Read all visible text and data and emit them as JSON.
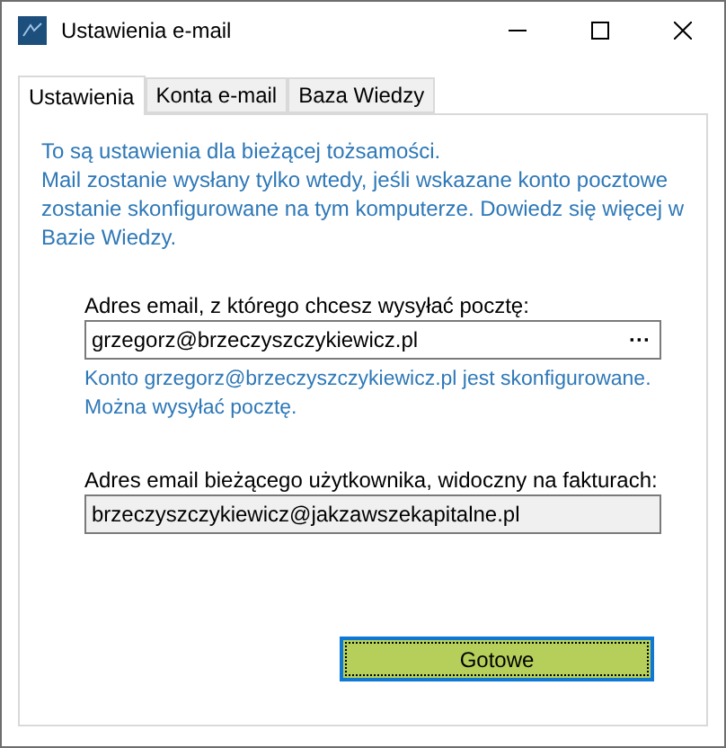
{
  "window": {
    "title": "Ustawienia e-mail"
  },
  "tabs": [
    {
      "label": "Ustawienia",
      "selected": true
    },
    {
      "label": "Konta e-mail",
      "selected": false
    },
    {
      "label": "Baza Wiedzy",
      "selected": false
    }
  ],
  "info_lines": [
    "To są ustawienia dla bieżącej tożsamości.",
    "Mail zostanie wysłany tylko wtedy, jeśli wskazane konto pocztowe zostanie skonfigurowane na tym komputerze. Dowiedz się więcej w Bazie Wiedzy."
  ],
  "sender_field": {
    "label": "Adres email, z którego chcesz wysyłać pocztę:",
    "value": "grzegorz@brzeczyszczykiewicz.pl",
    "browse_button": "···",
    "status": "Konto grzegorz@brzeczyszczykiewicz.pl jest skonfigurowane. Można wysyłać pocztę."
  },
  "invoice_field": {
    "label": "Adres email bieżącego użytkownika, widoczny na fakturach:",
    "value": "brzeczyszczykiewicz@jakzawszekapitalne.pl",
    "readonly": true
  },
  "done_button": {
    "label": "Gotowe"
  }
}
